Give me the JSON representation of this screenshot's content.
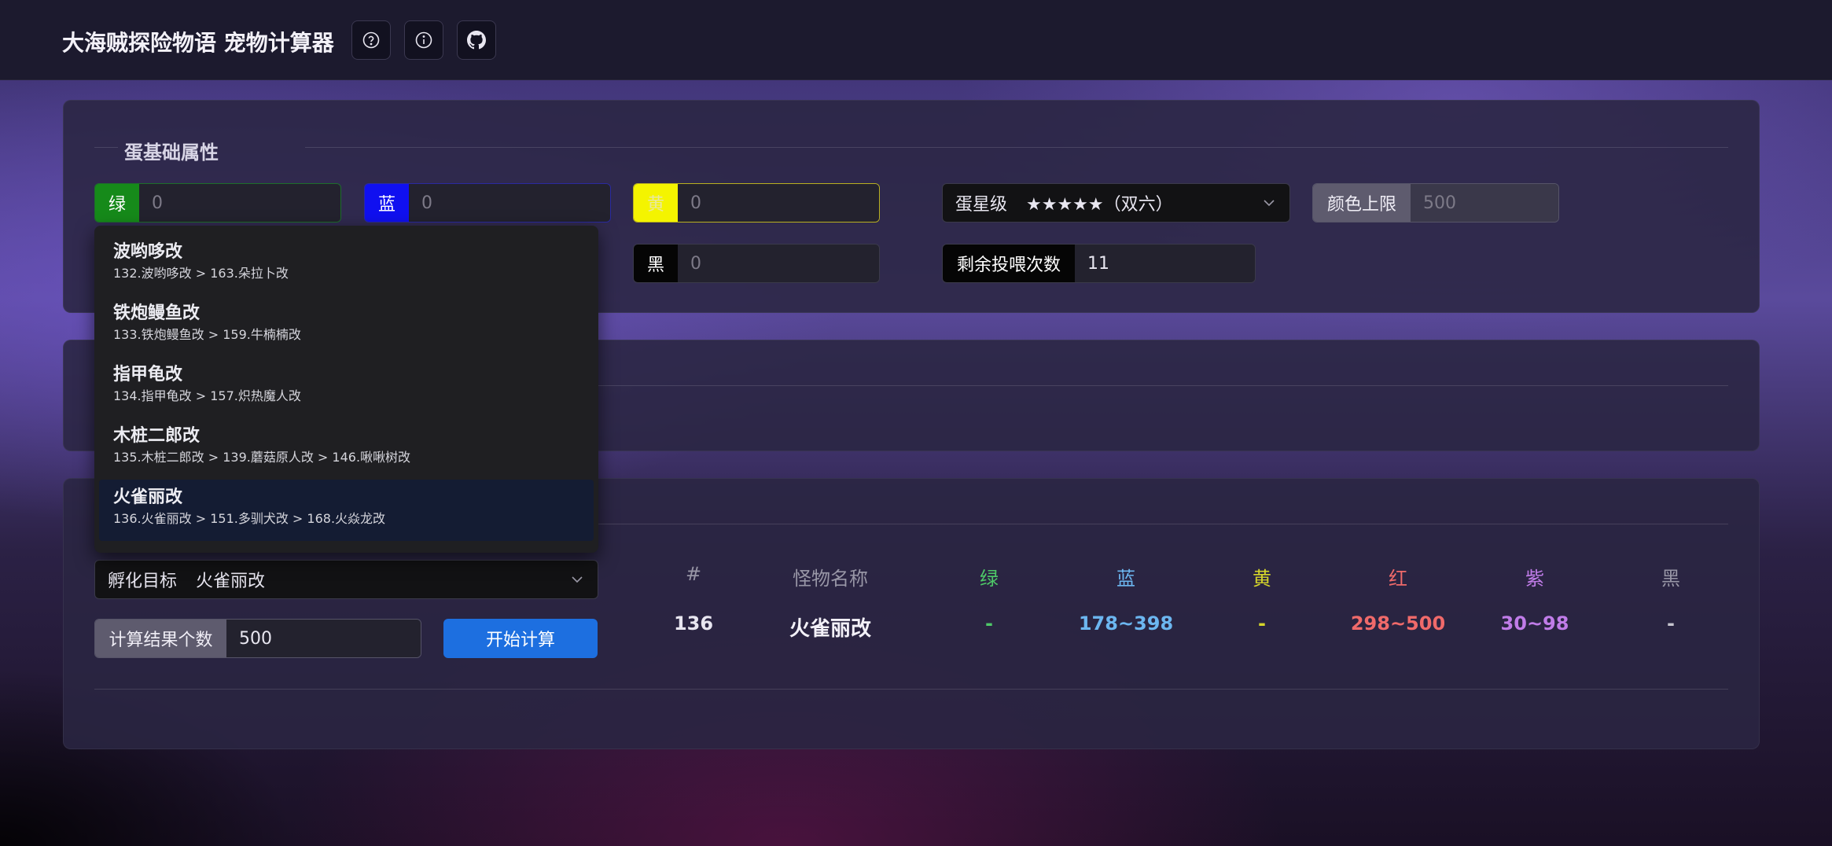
{
  "app": {
    "title": "大海贼探险物语 宠物计算器",
    "header_icons": [
      "help-icon",
      "info-icon",
      "github-icon"
    ]
  },
  "egg_section": {
    "title": "蛋基础属性",
    "colors": {
      "green_label": "绿",
      "green_value": "0",
      "blue_label": "蓝",
      "blue_value": "0",
      "yellow_label": "黄",
      "yellow_value": "0",
      "black_label": "黑",
      "black_value": "0"
    },
    "star_level": {
      "label": "蛋星级",
      "value": "★★★★★（双六）"
    },
    "color_limit": {
      "label": "颜色上限",
      "placeholder": "500"
    },
    "remaining_feeds": {
      "label": "剩余投喂次数",
      "value": "11"
    }
  },
  "target_dropdown": {
    "items": [
      {
        "name": "波哟哆改",
        "path": "132.波哟哆改 > 163.朵拉卜改"
      },
      {
        "name": "铁炮鳗鱼改",
        "path": "133.铁炮鳗鱼改 > 159.牛楠楠改"
      },
      {
        "name": "指甲龟改",
        "path": "134.指甲龟改 > 157.炽热魔人改"
      },
      {
        "name": "木桩二郎改",
        "path": "135.木桩二郎改 > 139.蘑菇原人改 > 146.啾啾树改"
      },
      {
        "name": "火雀丽改",
        "path": "136.火雀丽改 > 151.多驯犬改 > 168.火焱龙改",
        "active": true
      }
    ]
  },
  "calc": {
    "target_label": "孵化目标",
    "target_value": "火雀丽改",
    "result_count_label": "计算结果个数",
    "result_count_value": "500",
    "start_button": "开始计算"
  },
  "table": {
    "headers": [
      "#",
      "怪物名称",
      "绿",
      "蓝",
      "黄",
      "红",
      "紫",
      "黑"
    ],
    "rows": [
      [
        "136",
        "火雀丽改",
        "-",
        "178~398",
        "-",
        "298~500",
        "30~98",
        "-"
      ]
    ]
  },
  "theme": {
    "green": "#168a1a",
    "blue": "#1010f0",
    "yellow": "#f4f400",
    "col_green": "#4ec968",
    "col_blue": "#6cb6f0",
    "col_yellow": "#d6d62a",
    "col_red": "#f06a6a",
    "col_purple": "#c07ce8",
    "col_black": "#c7c5cf",
    "primary": "#1d6fe0"
  }
}
